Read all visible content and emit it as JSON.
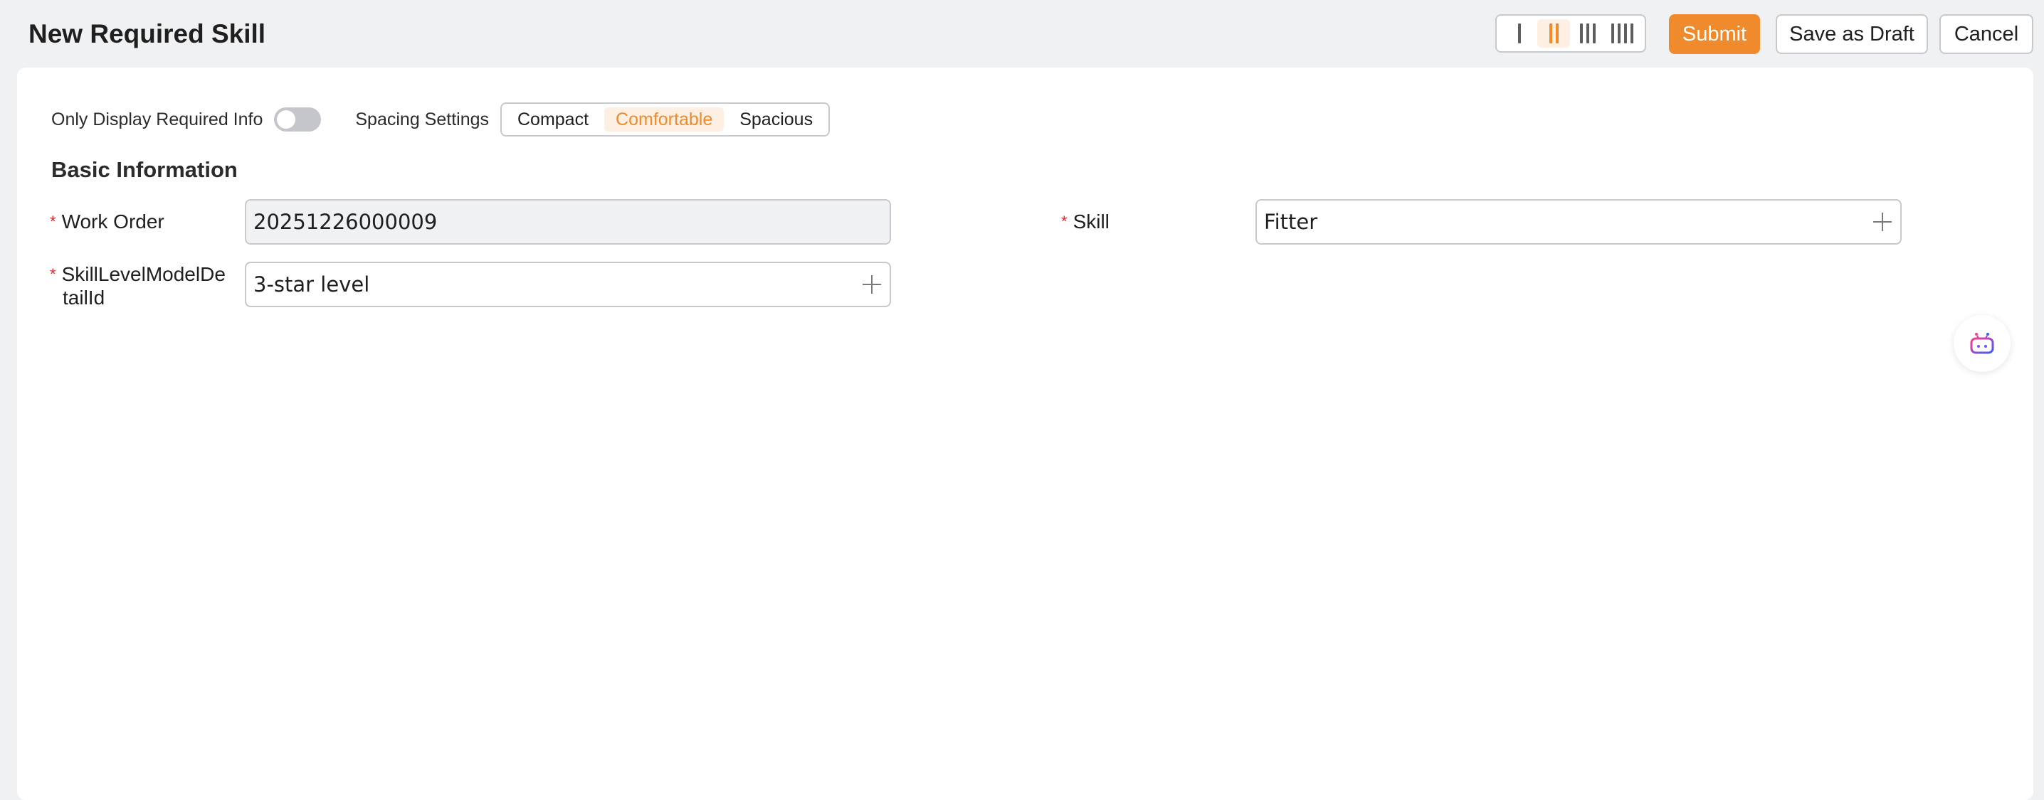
{
  "header": {
    "title": "New Required Skill",
    "layout_columns": [
      {
        "count": 1,
        "active": false
      },
      {
        "count": 2,
        "active": true
      },
      {
        "count": 3,
        "active": false
      },
      {
        "count": 4,
        "active": false
      }
    ],
    "submit_label": "Submit",
    "draft_label": "Save as Draft",
    "cancel_label": "Cancel"
  },
  "toolbar": {
    "only_required_label": "Only Display Required Info",
    "only_required_on": false,
    "spacing_label": "Spacing Settings",
    "spacing_options": [
      "Compact",
      "Comfortable",
      "Spacious"
    ],
    "spacing_selected": "Comfortable"
  },
  "form": {
    "section_title": "Basic Information",
    "work_order": {
      "label": "Work Order",
      "value": "20251226000009",
      "required": true
    },
    "skill": {
      "label": "Skill",
      "value": "Fitter",
      "required": true
    },
    "skill_level": {
      "label_line1": "SkillLevelModelDe",
      "label_line2": "tailId",
      "value": "3-star level",
      "required": true
    }
  },
  "icons": {
    "assistant": "robot-assistant-icon",
    "add": "plus-icon"
  },
  "colors": {
    "accent": "#ef8b2c",
    "required": "#e0282e",
    "readonly_bg": "#f0f1f3"
  }
}
